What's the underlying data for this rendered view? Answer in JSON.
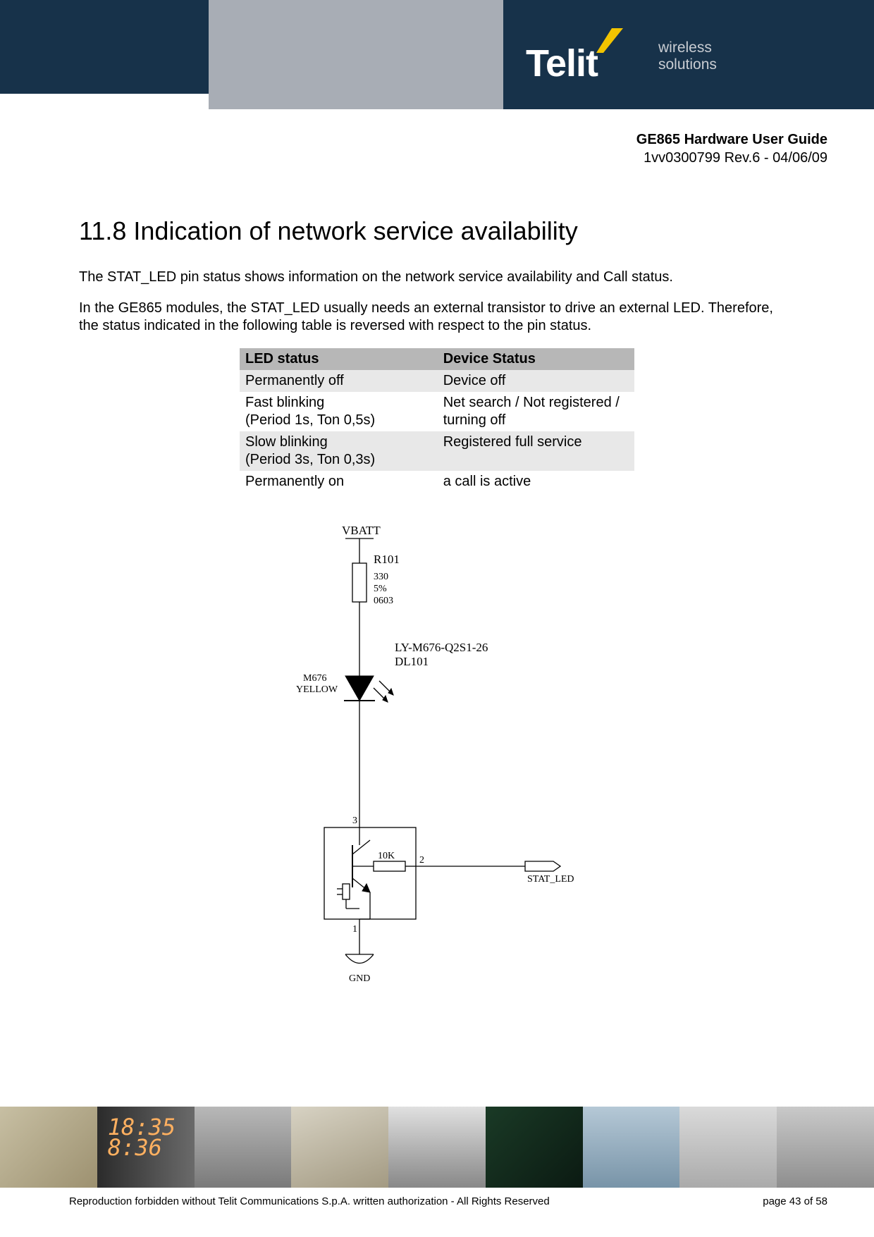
{
  "header": {
    "brand": "Telit",
    "tagline_line1": "wireless",
    "tagline_line2": "solutions"
  },
  "doc_meta": {
    "title": "GE865 Hardware User Guide",
    "revision": "1vv0300799 Rev.6 - 04/06/09"
  },
  "section": {
    "heading": "11.8 Indication of network service availability",
    "para1": "The STAT_LED pin status shows information on the network service availability and Call status.",
    "para2": "In the GE865 modules, the STAT_LED usually needs an external transistor to drive an external LED. Therefore, the status indicated in the following table is reversed with respect to the pin status."
  },
  "table": {
    "header": {
      "c1": "LED status",
      "c2": "Device Status"
    },
    "rows": [
      {
        "c1a": "Permanently off",
        "c1b": "",
        "c2a": "Device off",
        "c2b": ""
      },
      {
        "c1a": "Fast blinking",
        "c1b": "(Period 1s, Ton 0,5s)",
        "c2a": "Net search / Not registered /",
        "c2b": "turning off"
      },
      {
        "c1a": "Slow blinking",
        "c1b": "(Period 3s, Ton 0,3s)",
        "c2a": "Registered full service",
        "c2b": ""
      },
      {
        "c1a": "Permanently on",
        "c1b": "",
        "c2a": "a call is active",
        "c2b": ""
      }
    ]
  },
  "schematic": {
    "vbatt": "VBATT",
    "r_ref": "R101",
    "r_val": "330",
    "r_tol": "5%",
    "r_pkg": "0603",
    "led_part": "LY-M676-Q2S1-26",
    "led_ref": "DL101",
    "led_color_a": "M676",
    "led_color_b": "YELLOW",
    "pin1": "1",
    "pin2": "2",
    "pin3": "3",
    "r2_val": "10K",
    "signal": "STAT_LED",
    "gnd": "GND"
  },
  "footer": {
    "digits": "18:35\n8:36",
    "copyright": "Reproduction forbidden without Telit Communications S.p.A. written authorization - All Rights Reserved",
    "page": "page 43 of 58"
  }
}
